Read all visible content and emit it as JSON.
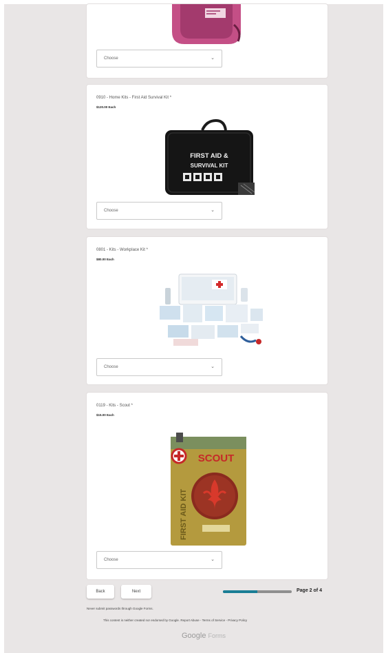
{
  "questions": [
    {
      "title": "",
      "price": "",
      "select_value": "Choose"
    },
    {
      "title": "0910 - Home Kits - First Aid Survival Kit *",
      "price": "$120.00 Each",
      "select_value": "Choose",
      "product_print": [
        "FIRST AID &",
        "SURVIVAL KIT"
      ]
    },
    {
      "title": "0801 - Kits - Workplace Kit *",
      "price": "$80.00 Each",
      "select_value": "Choose"
    },
    {
      "title": "0119 - Kits - Scout *",
      "price": "$15.00 Each",
      "select_value": "Choose",
      "product_print": [
        "SCOUT",
        "FIRST AID KIT"
      ]
    }
  ],
  "nav": {
    "back_label": "Back",
    "next_label": "Next"
  },
  "progress": {
    "fraction": 0.5,
    "label": "Page 2 of 4"
  },
  "footer": {
    "submit_note": "Never submit passwords through Google Forms.",
    "disclaimer": "This content is neither created nor endorsed by Google.",
    "report_abuse": "Report Abuse",
    "terms": "Terms of Service",
    "privacy": "Privacy Policy",
    "separator": "-",
    "brand_google": "Google",
    "brand_forms": "Forms"
  },
  "colors": {
    "background": "#e9e6e6",
    "accent": "#1a7d95",
    "card": "#ffffff"
  }
}
